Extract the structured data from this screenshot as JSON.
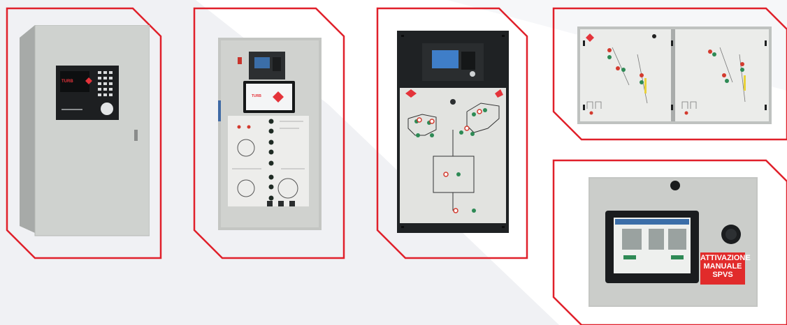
{
  "colors": {
    "frame_border": "#e0202a",
    "background": "#ffffff",
    "background_wedge": "#f0f1f4",
    "cabinet": "#c9ccca",
    "panel_face": "#e6e7e4"
  },
  "panels": [
    {
      "name": "wall-cabinet-with-keypad"
    },
    {
      "name": "control-cabinet-with-touchscreen"
    },
    {
      "name": "rack-panel-with-synoptic"
    },
    {
      "name": "dual-synoptic-panel"
    },
    {
      "name": "touchscreen-panel-manual-activation"
    }
  ],
  "label_attivazione": {
    "line1": "ATTIVAZIONE",
    "line2": "MANUALE",
    "line3": "SPVS"
  }
}
